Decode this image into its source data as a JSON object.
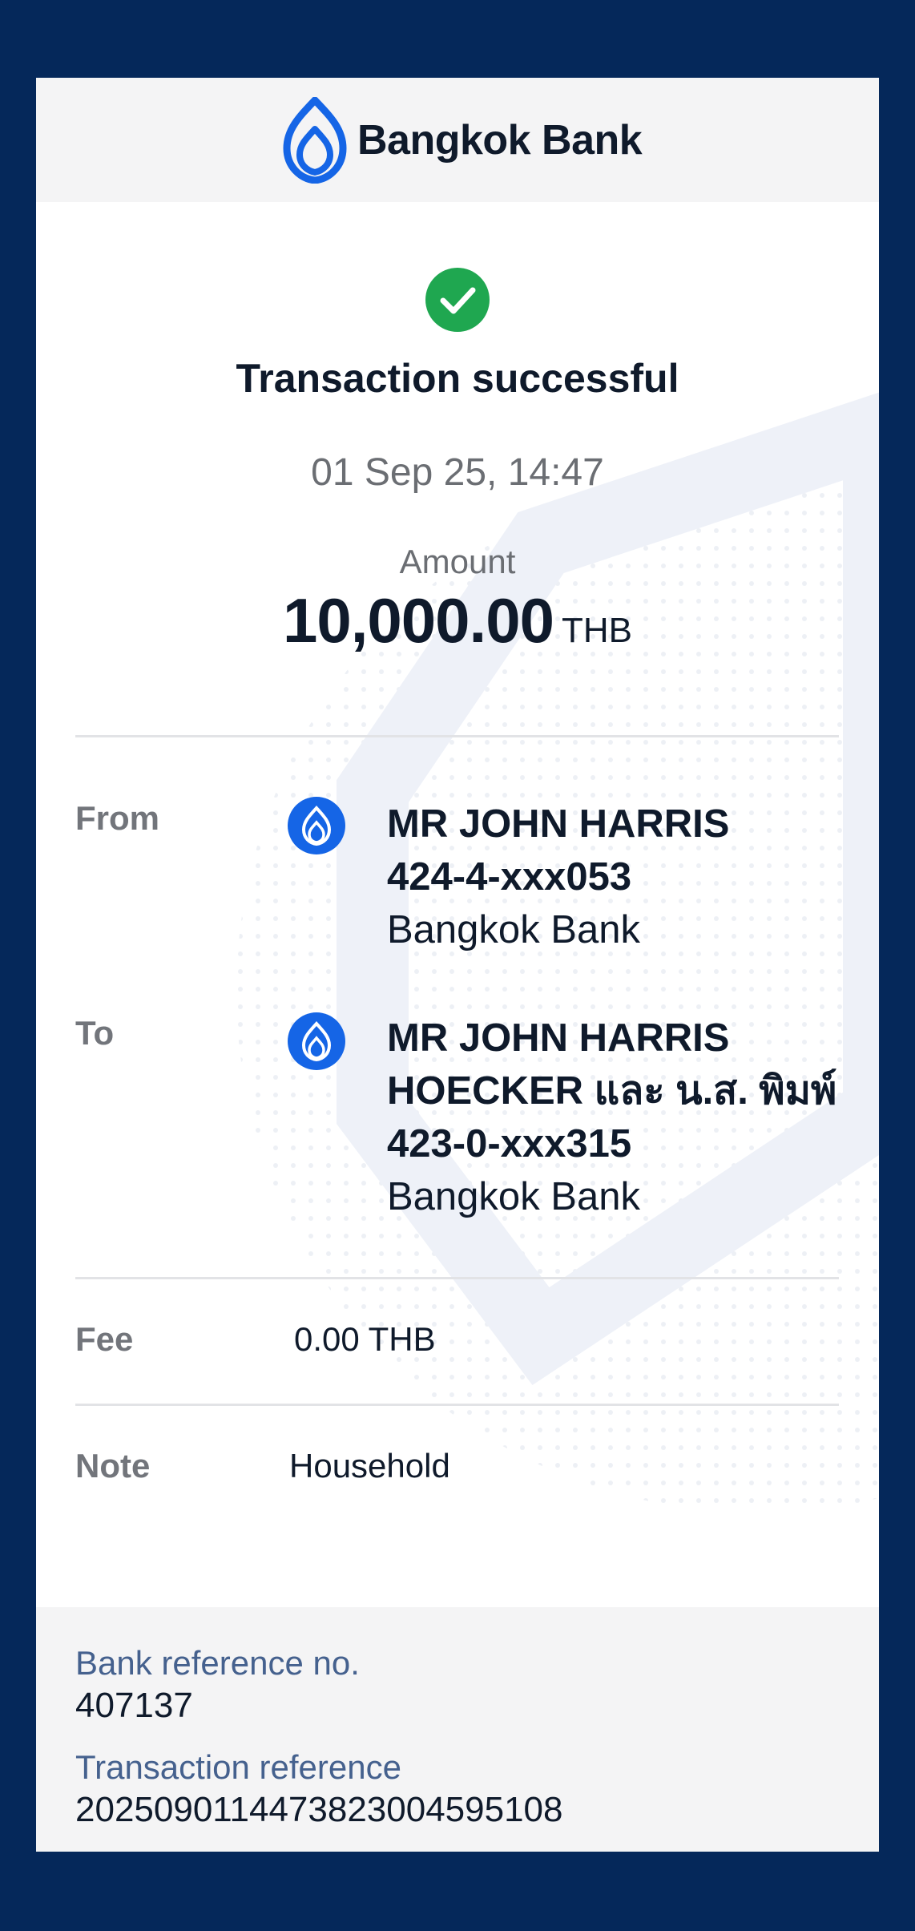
{
  "header": {
    "brand": "Bangkok Bank",
    "brand_color": "#1565e6"
  },
  "status": {
    "icon": "check-circle-icon",
    "color": "#1fa750",
    "title": "Transaction successful"
  },
  "datetime": "01 Sep 25, 14:47",
  "amount": {
    "label": "Amount",
    "value": "10,000.00",
    "currency": "THB"
  },
  "from": {
    "label": "From",
    "icon": "bangkok-bank-icon",
    "name": "MR JOHN HARRIS",
    "account": "424-4-xxx053",
    "bank": "Bangkok Bank"
  },
  "to": {
    "label": "To",
    "icon": "bangkok-bank-icon",
    "name_line1": "MR JOHN HARRIS",
    "name_line2": "HOECKER และ น.ส. พิมพ์",
    "account": "423-0-xxx315",
    "bank": "Bangkok Bank"
  },
  "fee": {
    "label": "Fee",
    "value": "0.00 THB"
  },
  "note": {
    "label": "Note",
    "value": "Household"
  },
  "references": {
    "bank_ref_label": "Bank reference no.",
    "bank_ref_value": "407137",
    "txn_ref_label": "Transaction reference",
    "txn_ref_value": "202509011447382300459510​8"
  }
}
